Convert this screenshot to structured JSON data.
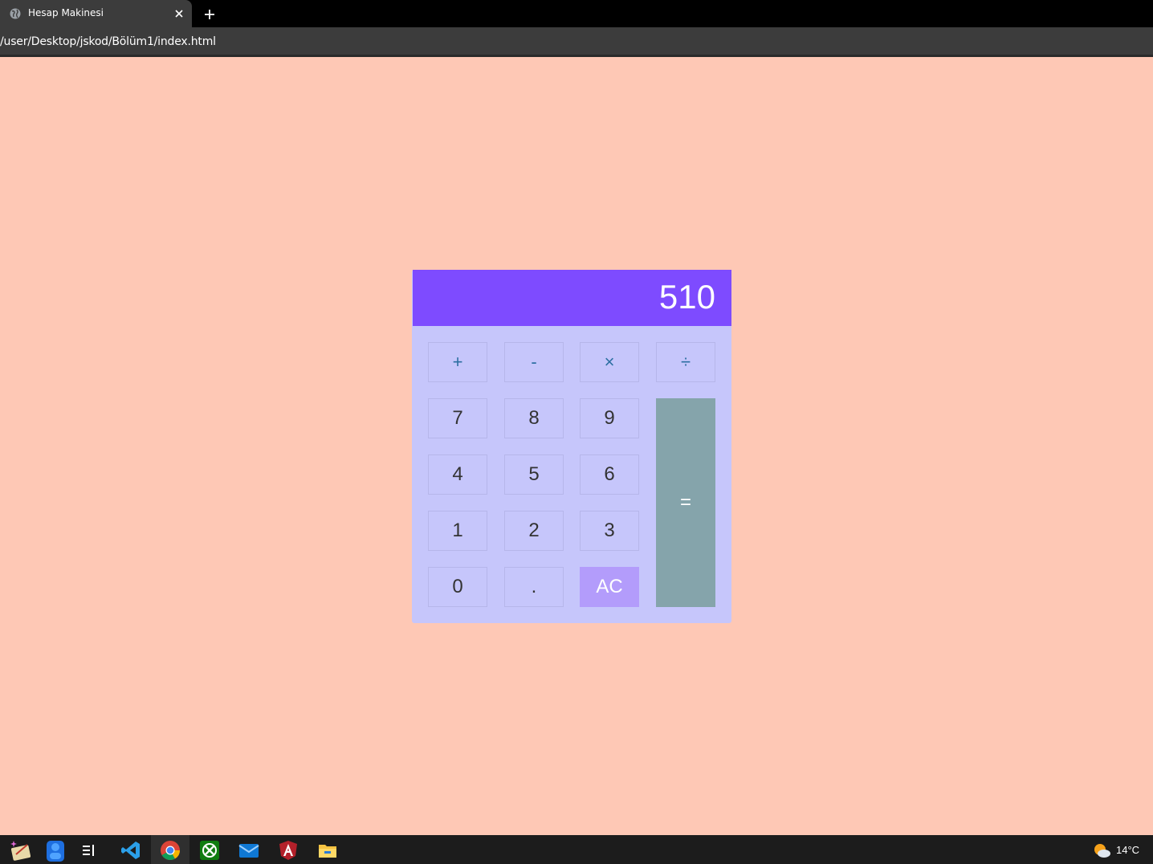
{
  "browser": {
    "tab_title": "Hesap Makinesi",
    "url": "/user/Desktop/jskod/Bölüm1/index.html"
  },
  "calculator": {
    "display_value": "510",
    "keys": {
      "add": "+",
      "subtract": "-",
      "multiply": "×",
      "divide": "÷",
      "seven": "7",
      "eight": "8",
      "nine": "9",
      "four": "4",
      "five": "5",
      "six": "6",
      "one": "1",
      "two": "2",
      "three": "3",
      "zero": "0",
      "decimal": ".",
      "clear": "AC",
      "equals": "="
    },
    "colors": {
      "page_background": "#fec8b5",
      "display_background": "#7e4bff",
      "body_background": "#c6c6fb",
      "clear_key": "#b39cfb",
      "equals_key": "#85a4ab",
      "operator_text": "#2c6fa1"
    }
  },
  "taskbar": {
    "apps": [
      "copilot-icon",
      "people-icon",
      "widgets-icon",
      "vscode-icon",
      "chrome-icon",
      "xbox-icon",
      "mail-icon",
      "angular-icon",
      "file-explorer-icon"
    ],
    "temperature": "14°C"
  }
}
